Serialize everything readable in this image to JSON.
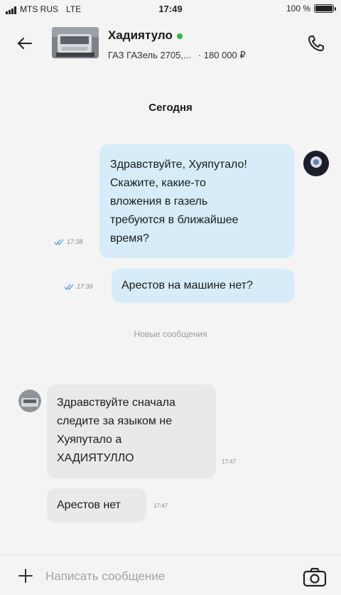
{
  "status_bar": {
    "carrier": "MTS RUS",
    "network": "LTE",
    "time": "17:49",
    "battery": "100 %"
  },
  "header": {
    "back_icon": "arrow-left-icon",
    "contact_name": "Хадиятуло",
    "online_color": "#3bb54a",
    "listing_title": "ГАЗ ГАЗель 2705,...",
    "listing_price": "· 180 000 ₽",
    "call_icon": "phone-icon"
  },
  "chat": {
    "day_label": "Сегодня",
    "new_messages_label": "Новые сообщения",
    "outgoing": [
      {
        "lines": [
          "Здравствуйте, Хуяпутало!",
          "Скажите, какие-то",
          "вложения в газель",
          "требуются в ближайшее",
          "время?"
        ],
        "time": "17:38"
      },
      {
        "lines": [
          "Арестов на машине нет?"
        ],
        "time": "17:39"
      }
    ],
    "incoming": [
      {
        "lines": [
          "Здравствуйте сначала",
          "следите за языком не",
          "Хуяпутало а",
          "ХАДИЯТУЛЛО"
        ],
        "time": "17:47"
      },
      {
        "lines": [
          "Арестов нет"
        ],
        "time": "17:47"
      }
    ]
  },
  "composer": {
    "placeholder": "Написать сообщение",
    "add_icon": "plus-icon",
    "camera_icon": "camera-icon"
  },
  "colors": {
    "outgoing_bubble": "#d6edf9",
    "incoming_bubble": "#e9e9e9",
    "read_ticks": "#4a9fd8"
  }
}
